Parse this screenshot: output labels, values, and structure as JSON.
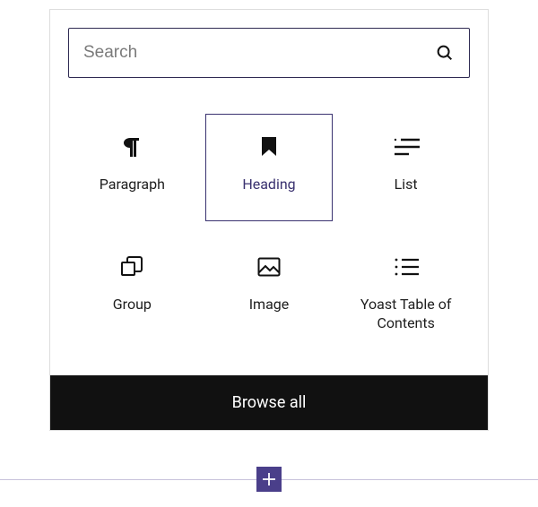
{
  "search": {
    "placeholder": "Search",
    "value": ""
  },
  "blocks": {
    "paragraph": {
      "label": "Paragraph"
    },
    "heading": {
      "label": "Heading"
    },
    "list": {
      "label": "List"
    },
    "group": {
      "label": "Group"
    },
    "image": {
      "label": "Image"
    },
    "yoast_toc": {
      "label": "Yoast Table of Contents"
    }
  },
  "selected_block": "heading",
  "browse_all_label": "Browse all",
  "icons": {
    "search": "search-icon",
    "add": "plus-icon"
  },
  "colors": {
    "accent": "#3a3270",
    "selected_border": "#3a3270",
    "browse_bg": "#111111",
    "add_bg": "#4a3f8a",
    "divider": "#c7c2db"
  }
}
